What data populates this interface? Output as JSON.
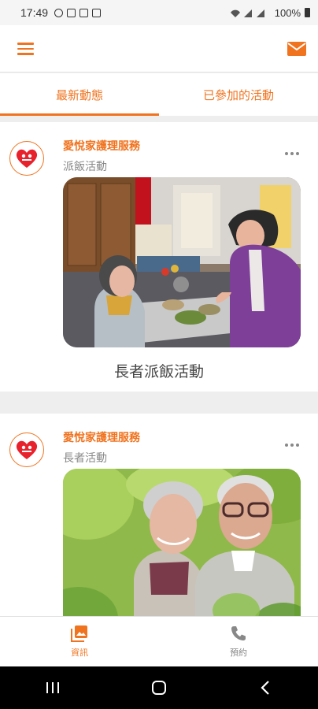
{
  "status_bar": {
    "time": "17:49",
    "battery": "100%"
  },
  "app_bar": {
    "menu_icon": "hamburger-menu-icon",
    "mail_icon": "mail-icon"
  },
  "tabs": [
    {
      "label": "最新動態",
      "active": true
    },
    {
      "label": "已參加的活動",
      "active": false
    }
  ],
  "feed": [
    {
      "org_name": "愛悅家護理服務",
      "category": "派飯活動",
      "title": "長者派飯活動",
      "image": "elderly-woman-receiving-meal-photo"
    },
    {
      "org_name": "愛悅家護理服務",
      "category": "長者活動",
      "title": "",
      "image": "elderly-couple-smiling-photo"
    }
  ],
  "bottom_nav": [
    {
      "label": "資訊",
      "icon": "photo-library-icon",
      "active": true
    },
    {
      "label": "預約",
      "icon": "phone-icon",
      "active": false
    }
  ],
  "colors": {
    "accent": "#f0731f",
    "text_secondary": "#888888"
  }
}
